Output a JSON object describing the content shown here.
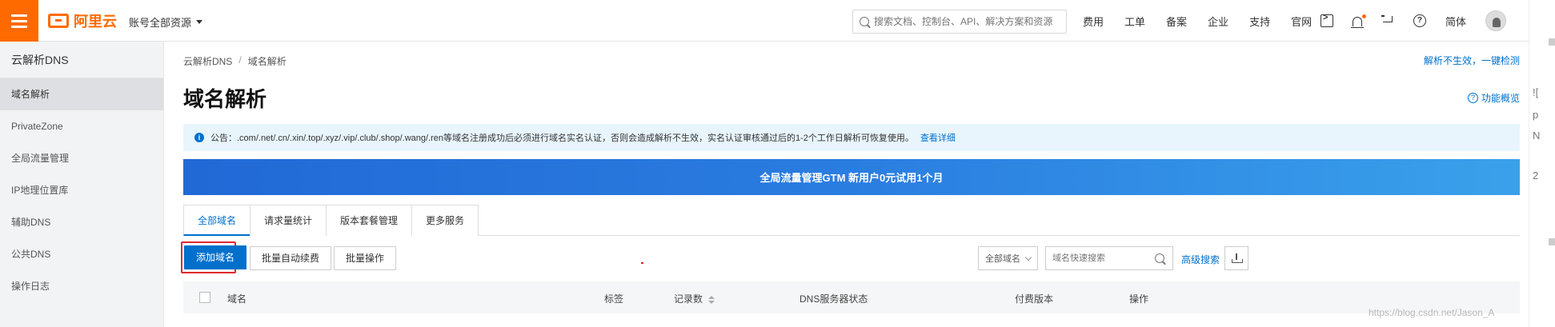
{
  "topbar": {
    "logo_text": "阿里云",
    "account_label": "账号全部资源",
    "search_placeholder": "搜索文档、控制台、API、解决方案和资源",
    "nav_items": [
      "费用",
      "工单",
      "备案",
      "企业",
      "支持",
      "官网"
    ],
    "language": "简体",
    "brand_color": "#ff6a00"
  },
  "sidebar": {
    "title": "云解析DNS",
    "items": [
      {
        "label": "域名解析",
        "active": true
      },
      {
        "label": "PrivateZone"
      },
      {
        "label": "全局流量管理"
      },
      {
        "label": "IP地理位置库"
      },
      {
        "label": "辅助DNS"
      },
      {
        "label": "公共DNS"
      },
      {
        "label": "操作日志"
      }
    ]
  },
  "main": {
    "breadcrumb": [
      "云解析DNS",
      "域名解析"
    ],
    "breadcrumb_sep": "/",
    "top_right_link": "解析不生效，一键检测",
    "title": "域名解析",
    "overview_link": "功能概览",
    "notice": {
      "text": "公告：.com/.net/.cn/.xin/.top/.xyz/.vip/.club/.shop/.wang/.ren等域名注册成功后必须进行域名实名认证，否则会造成解析不生效，实名认证审核通过后的1-2个工作日解析可恢复使用。",
      "link": "查看详细"
    },
    "banner_text": "全局流量管理GTM 新用户0元试用1个月",
    "tabs": [
      {
        "label": "全部域名",
        "active": true
      },
      {
        "label": "请求量统计"
      },
      {
        "label": "版本套餐管理"
      },
      {
        "label": "更多服务"
      }
    ],
    "toolbar": {
      "add_domain": "添加域名",
      "batch_renew": "批量自动续费",
      "batch_ops": "批量操作",
      "filter_select": "全部域名",
      "search_placeholder": "域名快速搜索",
      "advanced_search": "高级搜索"
    },
    "table": {
      "columns": [
        "域名",
        "标签",
        "记录数",
        "DNS服务器状态",
        "付费版本",
        "操作"
      ]
    },
    "accent_color": "#0070cc"
  },
  "watermark": "https://blog.csdn.net/Jason_A",
  "right_fragments": [
    "![",
    "p",
    "N",
    "2"
  ]
}
